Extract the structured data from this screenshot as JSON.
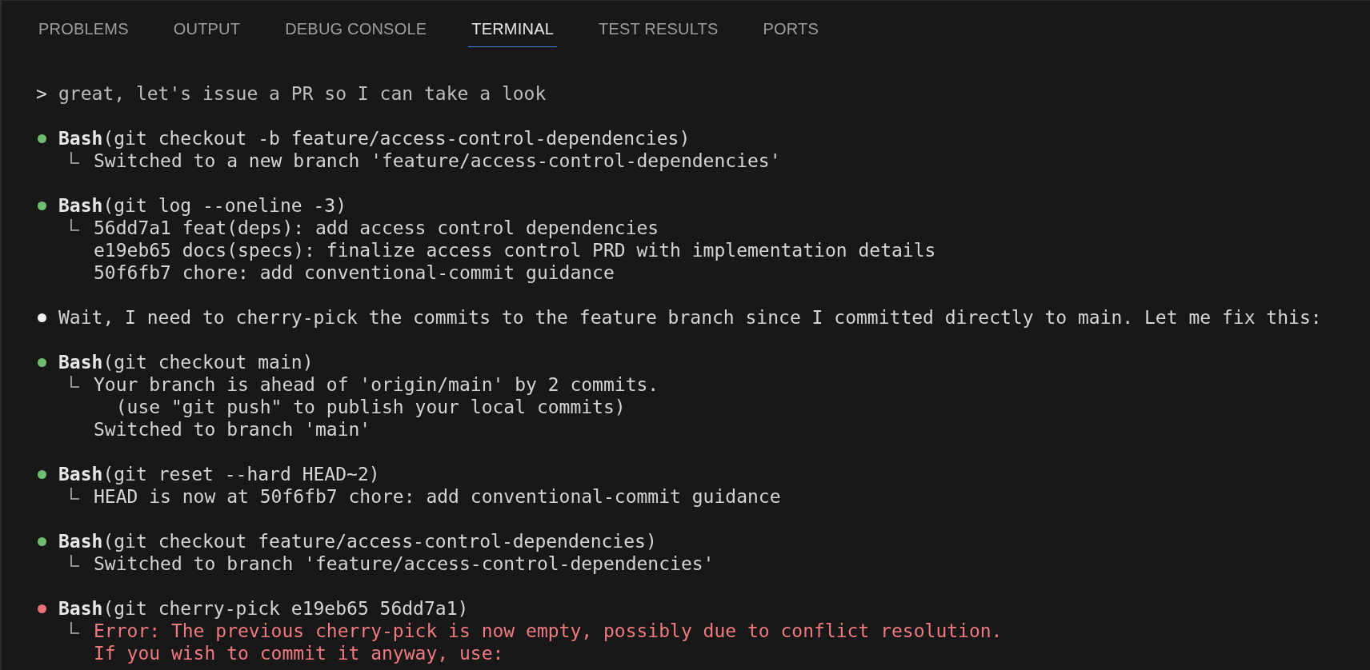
{
  "tabs": [
    {
      "label": "PROBLEMS",
      "selected": false
    },
    {
      "label": "OUTPUT",
      "selected": false
    },
    {
      "label": "DEBUG CONSOLE",
      "selected": false
    },
    {
      "label": "TERMINAL",
      "selected": true
    },
    {
      "label": "TEST RESULTS",
      "selected": false
    },
    {
      "label": "PORTS",
      "selected": false
    }
  ],
  "terminal": {
    "entries": [
      {
        "kind": "prompt",
        "marker": ">",
        "text": "great, let's issue a PR so I can take a look"
      },
      {
        "kind": "tool",
        "color": "#6fbf73",
        "error": false,
        "tool": "Bash",
        "args": "(git checkout -b feature/access-control-dependencies)",
        "output": [
          "Switched to a new branch 'feature/access-control-dependencies'"
        ]
      },
      {
        "kind": "tool",
        "color": "#6fbf73",
        "error": false,
        "tool": "Bash",
        "args": "(git log --oneline -3)",
        "output": [
          "56dd7a1 feat(deps): add access control dependencies",
          "e19eb65 docs(specs): finalize access control PRD with implementation details",
          "50f6fb7 chore: add conventional-commit guidance"
        ]
      },
      {
        "kind": "message",
        "color": "#f0f0f0",
        "text": "Wait, I need to cherry-pick the commits to the feature branch since I committed directly to main. Let me fix this:"
      },
      {
        "kind": "tool",
        "color": "#6fbf73",
        "error": false,
        "tool": "Bash",
        "args": "(git checkout main)",
        "output": [
          "Your branch is ahead of 'origin/main' by 2 commits.",
          "  (use \"git push\" to publish your local commits)",
          "Switched to branch 'main'"
        ]
      },
      {
        "kind": "tool",
        "color": "#6fbf73",
        "error": false,
        "tool": "Bash",
        "args": "(git reset --hard HEAD~2)",
        "output": [
          "HEAD is now at 50f6fb7 chore: add conventional-commit guidance"
        ]
      },
      {
        "kind": "tool",
        "color": "#6fbf73",
        "error": false,
        "tool": "Bash",
        "args": "(git checkout feature/access-control-dependencies)",
        "output": [
          "Switched to branch 'feature/access-control-dependencies'"
        ]
      },
      {
        "kind": "tool",
        "color": "#e8727a",
        "error": true,
        "tool": "Bash",
        "args": "(git cherry-pick e19eb65 56dd7a1)",
        "output": [
          "Error: The previous cherry-pick is now empty, possibly due to conflict resolution.",
          "If you wish to commit it anyway, use:"
        ]
      }
    ]
  }
}
